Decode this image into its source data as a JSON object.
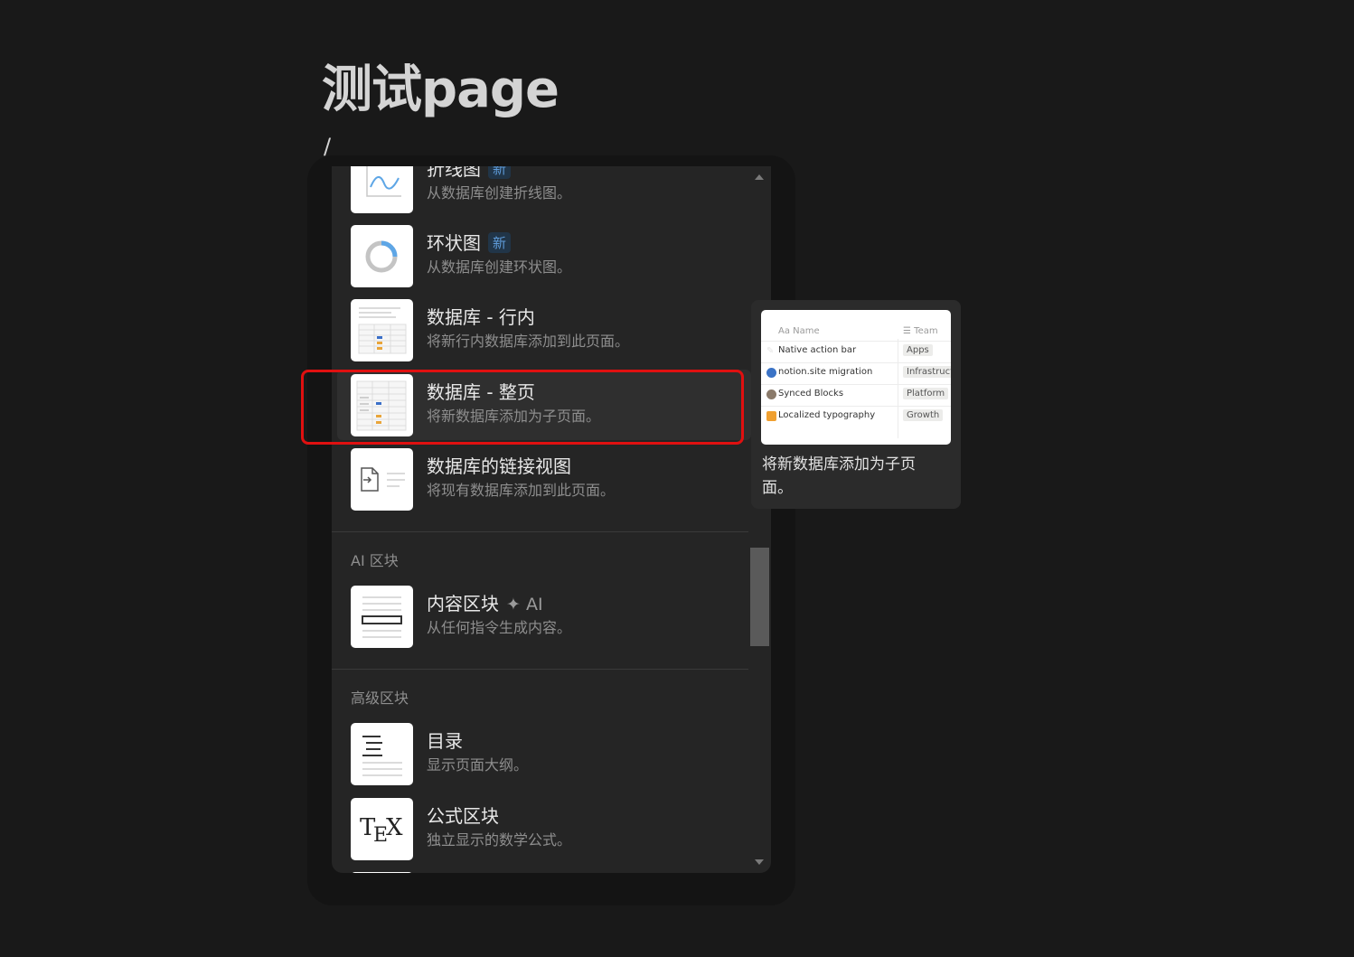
{
  "page": {
    "title": "测试page",
    "slash": "/"
  },
  "menu": {
    "items_top": [
      {
        "title": "折线图",
        "badge": "新",
        "desc": "从数据库创建折线图。",
        "icon": "line-chart-icon"
      },
      {
        "title": "环状图",
        "badge": "新",
        "desc": "从数据库创建环状图。",
        "icon": "donut-chart-icon"
      },
      {
        "title": "数据库 - 行内",
        "desc": "将新行内数据库添加到此页面。",
        "icon": "database-inline-icon"
      },
      {
        "title": "数据库 - 整页",
        "desc": "将新数据库添加为子页面。",
        "icon": "database-full-page-icon"
      },
      {
        "title": "数据库的链接视图",
        "desc": "将现有数据库添加到此页面。",
        "icon": "linked-database-icon"
      }
    ],
    "section_ai": {
      "label": "AI 区块",
      "items": [
        {
          "title": "内容区块",
          "ai_tag": "AI",
          "desc": "从任何指令生成内容。",
          "icon": "content-block-icon"
        }
      ]
    },
    "section_advanced": {
      "label": "高级区块",
      "items": [
        {
          "title": "目录",
          "desc": "显示页面大纲。",
          "icon": "table-of-contents-icon"
        },
        {
          "title": "公式区块",
          "desc": "独立显示的数学公式。",
          "icon": "tex-icon"
        }
      ]
    }
  },
  "preview": {
    "header_name": "Name",
    "header_team": "Team",
    "rows": [
      {
        "name": "Native action bar",
        "team": "Apps"
      },
      {
        "name": "notion.site migration",
        "team": "Infrastruct"
      },
      {
        "name": "Synced Blocks",
        "team": "Platform"
      },
      {
        "name": "Localized typography",
        "team": "Growth"
      }
    ],
    "caption": "将新数据库添加为子页面。"
  },
  "colors": {
    "background": "#191919",
    "menu": "#252525",
    "highlight": "#e01010",
    "badge": "#5e9bd9"
  }
}
